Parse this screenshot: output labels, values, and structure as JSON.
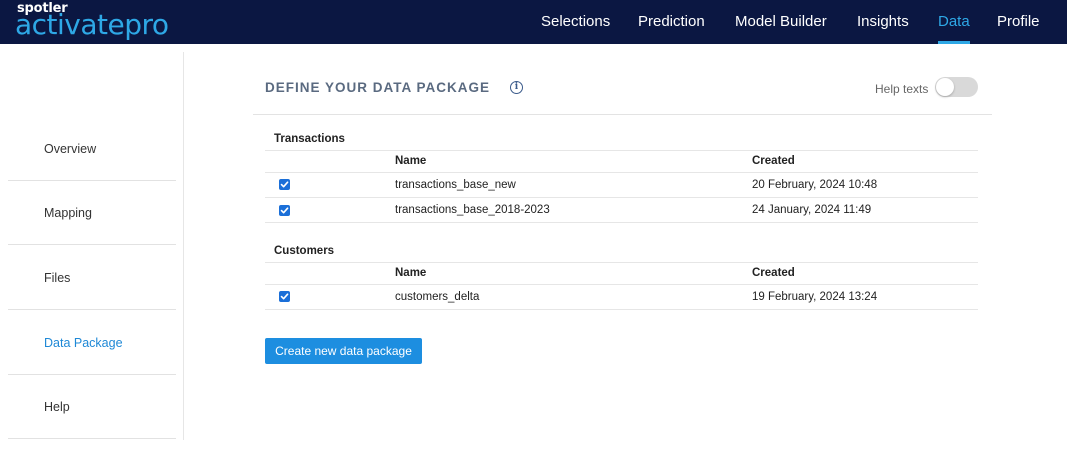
{
  "app": {
    "logo_top": "spotler",
    "logo_main": "activatepro",
    "accent_color": "#2ea8e6",
    "topbar_color": "#0b1742"
  },
  "nav": {
    "items": [
      {
        "label": "Selections",
        "active": false
      },
      {
        "label": "Prediction",
        "active": false
      },
      {
        "label": "Model Builder",
        "active": false
      },
      {
        "label": "Insights",
        "active": false
      },
      {
        "label": "Data",
        "active": true
      },
      {
        "label": "Profile",
        "active": false
      }
    ]
  },
  "sidebar": {
    "items": [
      {
        "label": "Overview",
        "active": false
      },
      {
        "label": "Mapping",
        "active": false
      },
      {
        "label": "Files",
        "active": false
      },
      {
        "label": "Data Package",
        "active": true
      },
      {
        "label": "Help",
        "active": false
      }
    ]
  },
  "main": {
    "title": "DEFINE YOUR DATA PACKAGE",
    "info_icon": "info-icon",
    "help_texts_label": "Help texts",
    "help_texts_enabled": false,
    "sections": [
      {
        "title": "Transactions",
        "columns": [
          "Name",
          "Created"
        ],
        "rows": [
          {
            "checked": true,
            "name": "transactions_base_new",
            "created": "20 February, 2024 10:48"
          },
          {
            "checked": true,
            "name": "transactions_base_2018-2023",
            "created": "24 January, 2024 11:49"
          }
        ]
      },
      {
        "title": "Customers",
        "columns": [
          "Name",
          "Created"
        ],
        "rows": [
          {
            "checked": true,
            "name": "customers_delta",
            "created": "19 February, 2024 13:24"
          }
        ]
      }
    ],
    "create_button_label": "Create new data package"
  }
}
